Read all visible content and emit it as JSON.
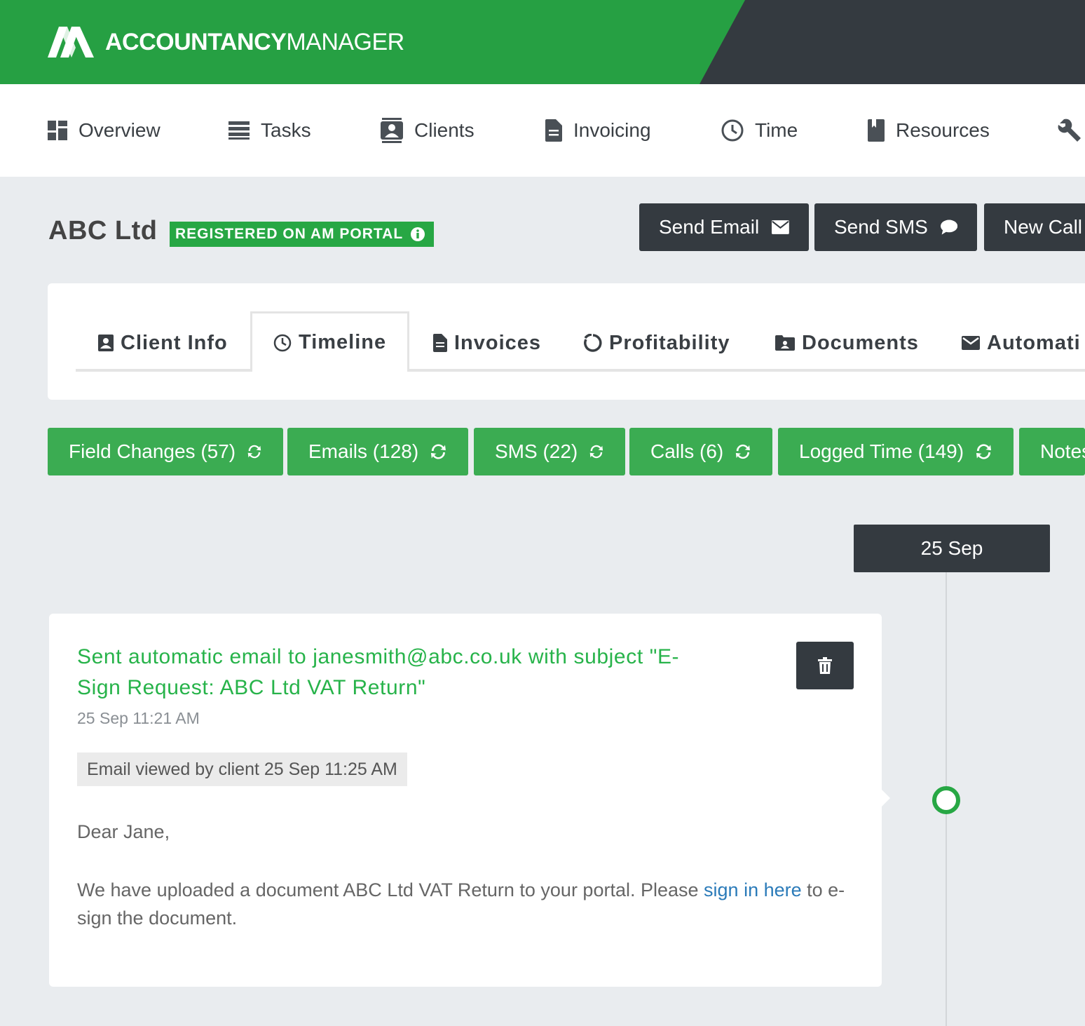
{
  "brand": {
    "logo_bold": "ACCOUNTANCY",
    "logo_light": "MANAGER",
    "green": "#26a043",
    "dark": "#343a40"
  },
  "nav": {
    "items": [
      {
        "label": "Overview",
        "icon": "dashboard-icon"
      },
      {
        "label": "Tasks",
        "icon": "list-icon"
      },
      {
        "label": "Clients",
        "icon": "contacts-icon"
      },
      {
        "label": "Invoicing",
        "icon": "document-icon"
      },
      {
        "label": "Time",
        "icon": "clock-icon"
      },
      {
        "label": "Resources",
        "icon": "book-icon"
      },
      {
        "label": "",
        "icon": "wrench-icon"
      }
    ]
  },
  "client": {
    "name": "ABC Ltd",
    "badge": "REGISTERED ON AM PORTAL"
  },
  "actions": {
    "send_email": "Send Email",
    "send_sms": "Send SMS",
    "new_call": "New Call"
  },
  "tabs": [
    {
      "label": "Client Info",
      "icon": "id-card-icon"
    },
    {
      "label": "Timeline",
      "icon": "clock-icon",
      "active": true
    },
    {
      "label": "Invoices",
      "icon": "document-icon"
    },
    {
      "label": "Profitability",
      "icon": "pie-icon"
    },
    {
      "label": "Documents",
      "icon": "folder-icon"
    },
    {
      "label": "Automati",
      "icon": "mail-icon"
    }
  ],
  "filters": [
    {
      "label": "Field Changes (57)"
    },
    {
      "label": "Emails (128)"
    },
    {
      "label": "SMS (22)"
    },
    {
      "label": "Calls (6)"
    },
    {
      "label": "Logged Time (149)"
    },
    {
      "label": "Notes"
    }
  ],
  "timeline": {
    "date": "25 Sep",
    "entry": {
      "title": "Sent automatic email to janesmith@abc.co.uk with subject \"E-Sign Request: ABC Ltd VAT Return\"",
      "time": "25 Sep 11:21 AM",
      "viewed": "Email viewed by client 25 Sep 11:25 AM",
      "greeting": "Dear Jane,",
      "body_before": "We have uploaded a document ABC Ltd VAT Return to your portal. Please ",
      "link": "sign in here",
      "body_after": " to e-sign the document."
    }
  }
}
